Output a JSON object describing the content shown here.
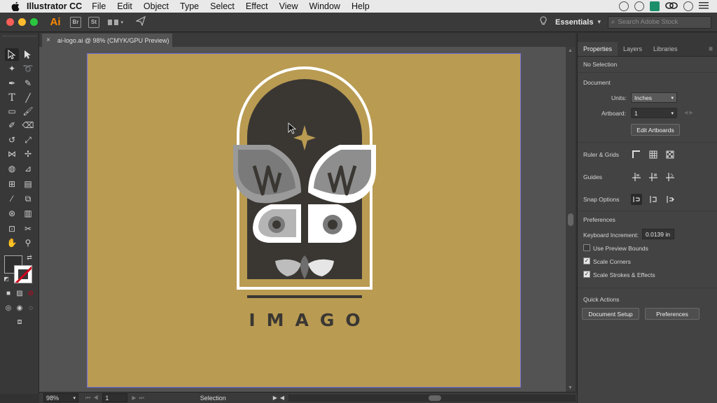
{
  "menubar": {
    "app_name": "Illustrator CC",
    "items": [
      "File",
      "Edit",
      "Object",
      "Type",
      "Select",
      "Effect",
      "View",
      "Window",
      "Help"
    ]
  },
  "appbar": {
    "logo": "Ai",
    "bridge": "Br",
    "stock": "St",
    "workspace": "Essentials",
    "search_placeholder": "Search Adobe Stock"
  },
  "document": {
    "tab_title": "ai-logo.ai @ 98% (CMYK/GPU Preview)"
  },
  "artwork": {
    "logo_text": "IMAGO",
    "background_color": "#b99b52",
    "dark_color": "#3a3733"
  },
  "statusbar": {
    "zoom": "98%",
    "artboard_number": "1",
    "tool_status": "Selection"
  },
  "panel": {
    "tabs": [
      "Properties",
      "Layers",
      "Libraries"
    ],
    "selection_status": "No Selection",
    "document_heading": "Document",
    "units_label": "Units:",
    "units_value": "Inches",
    "artboard_label": "Artboard:",
    "artboard_value": "1",
    "edit_artboards": "Edit Artboards",
    "ruler_grids": "Ruler & Grids",
    "guides": "Guides",
    "snap_options": "Snap Options",
    "preferences_heading": "Preferences",
    "keyboard_increment_label": "Keyboard Increment:",
    "keyboard_increment_value": "0.0139 in",
    "use_preview_bounds": "Use Preview Bounds",
    "use_preview_bounds_checked": false,
    "scale_corners": "Scale Corners",
    "scale_corners_checked": true,
    "scale_strokes": "Scale Strokes & Effects",
    "scale_strokes_checked": true,
    "quick_actions": "Quick Actions",
    "document_setup": "Document Setup",
    "preferences_button": "Preferences"
  }
}
